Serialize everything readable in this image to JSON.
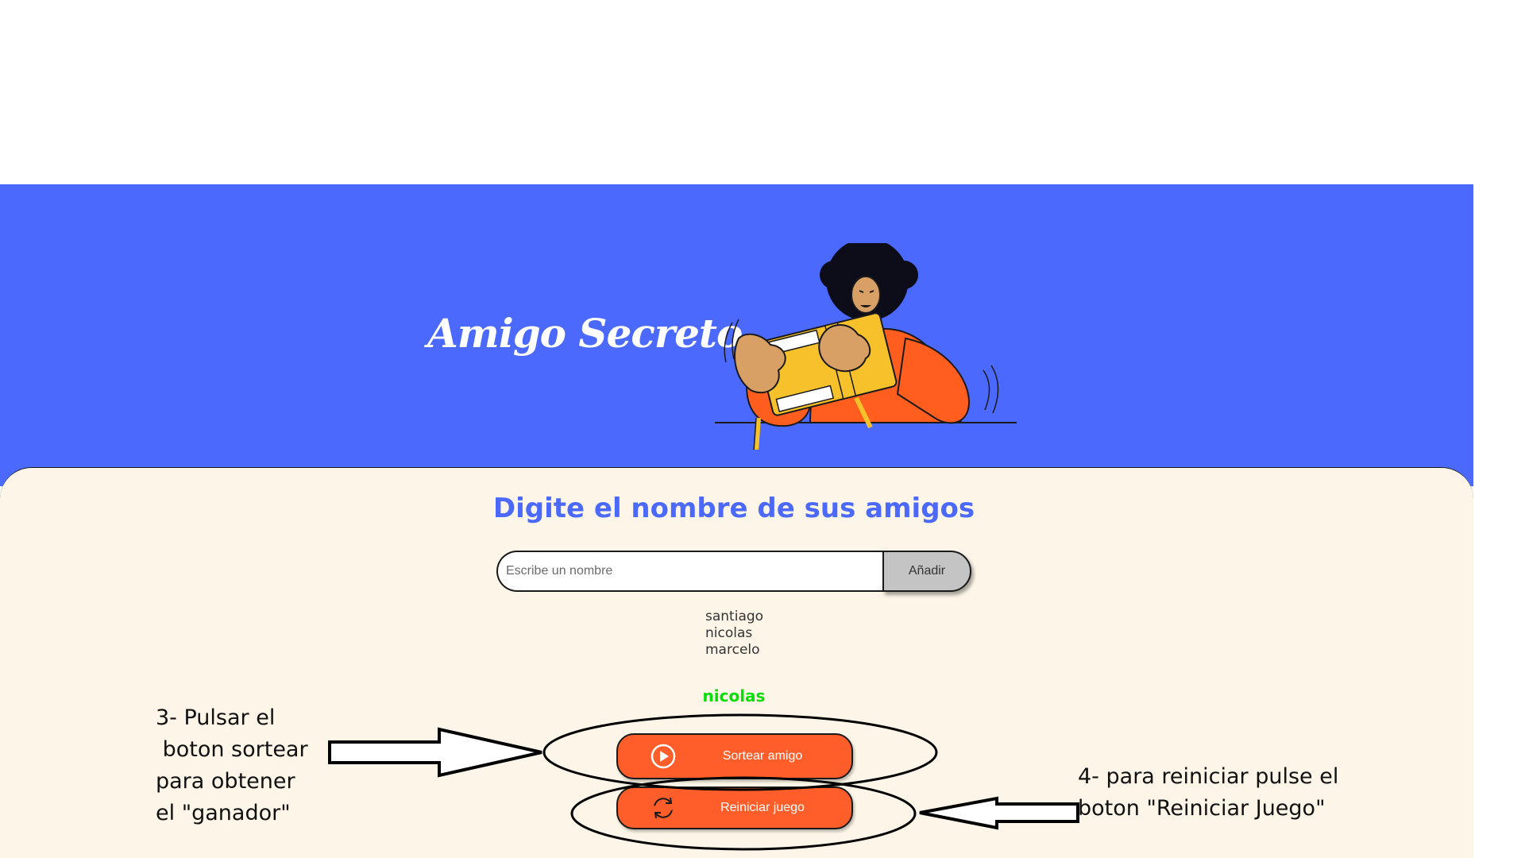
{
  "header": {
    "title": "Amigo Secreto"
  },
  "main": {
    "heading": "Digite el nombre de sus amigos",
    "input_placeholder": "Escribe un nombre",
    "add_label": "Añadir",
    "friends": [
      "santiago",
      "nicolas",
      "marcelo"
    ],
    "result": "nicolas",
    "draw_label": "Sortear amigo",
    "reset_label": "Reiniciar juego"
  },
  "annotations": {
    "left_lines": [
      "3- Pulsar el",
      " boton sortear",
      "para obtener",
      "el \"ganador\""
    ],
    "right_lines": [
      "4- para reiniciar pulse el",
      "boton \"Reiniciar Juego\""
    ]
  },
  "icons": {
    "draw": "play-circle-icon",
    "reset": "reset-icon"
  },
  "colors": {
    "header_blue": "#4b69fd",
    "cream": "#fdf6e8",
    "orange": "#ff5e2a",
    "result_green": "#05df05",
    "button_gray": "#c4c4c4"
  }
}
